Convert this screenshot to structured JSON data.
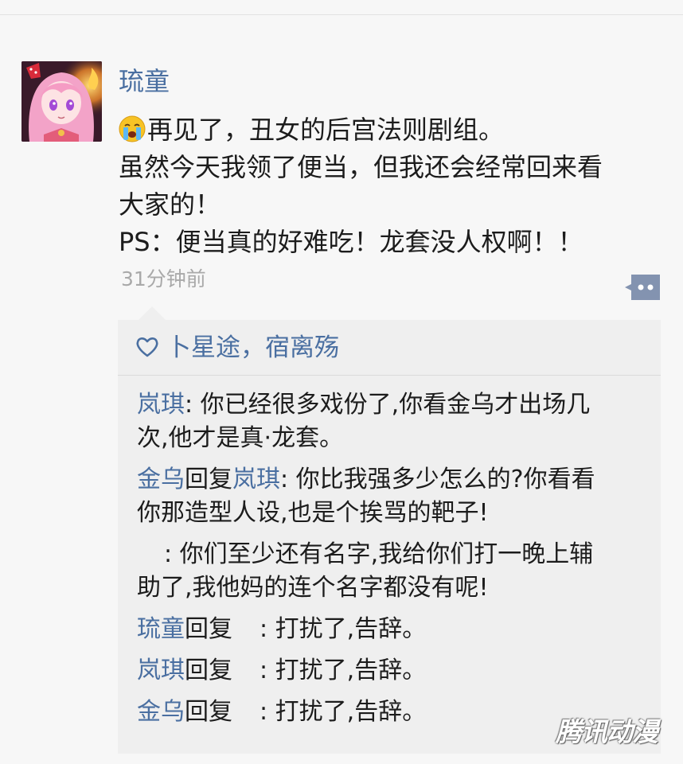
{
  "post": {
    "user_name": "琉童",
    "emoji_icon": "crying-face-emoji",
    "lines": [
      "再见了，丑女的后宫法则剧组。",
      "虽然今天我领了便当，但我还会经常回来看",
      "大家的！",
      "PS：便当真的好难吃！龙套没人权啊！！"
    ],
    "time": "31分钟前"
  },
  "likes": {
    "icon": "heart-outline-icon",
    "names": "卜星途，宿离殇"
  },
  "comments": [
    {
      "author": "岚琪",
      "sep": ": ",
      "line1": "你已经很多戏份了,你看金乌才出场几",
      "line2": "次,他才是真·龙套。"
    },
    {
      "author": "金乌",
      "reply": "回复",
      "target": "岚琪",
      "sep": ": ",
      "line1": "你比我强多少怎么的?你看看",
      "line2": "你那造型人设,也是个挨骂的靶子!"
    },
    {
      "sep": ": ",
      "line1": "你们至少还有名字,我给你们打一晚上辅",
      "line2": "助了,我他妈的连个名字都没有呢!"
    },
    {
      "author": "琉童",
      "reply": "回复",
      "sep": ": ",
      "text": "打扰了,告辞。"
    },
    {
      "author": "岚琪",
      "reply": "回复",
      "sep": ": ",
      "text": "打扰了,告辞。"
    },
    {
      "author": "金乌",
      "reply": "回复",
      "sep": ": ",
      "text": "打扰了,告辞。"
    }
  ],
  "watermark": "腾讯动漫",
  "colors": {
    "name_blue": "#4a6fa1",
    "text": "#1c1c1c",
    "time_gray": "#a9a9a9",
    "panel_bg": "#efefef",
    "page_bg": "#f7f7f7"
  }
}
